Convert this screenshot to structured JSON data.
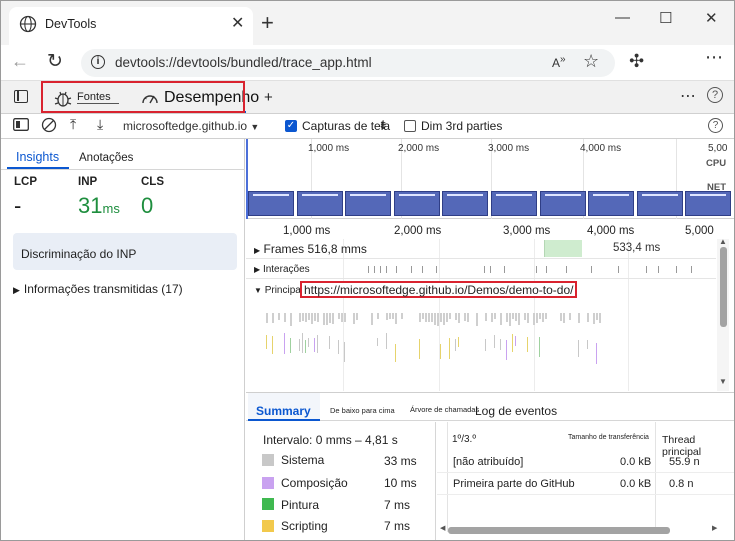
{
  "browser": {
    "tab_title": "DevTools",
    "tab_close": "✕",
    "new_tab": "+",
    "address": "devtools://devtools/bundled/trace_app.html",
    "window_controls": [
      "—",
      "☐",
      "✕"
    ]
  },
  "devtools": {
    "tabs": [
      {
        "label": "Fontes",
        "icon": "bug-icon"
      },
      {
        "label": "Desempenho",
        "icon": "speedometer-icon"
      }
    ],
    "add_tab": "+",
    "more": "⋯"
  },
  "perf_toolbar": {
    "recording_select": "microsoftedge.github.io",
    "screenshots_label": "Capturas de tela",
    "screenshots_checked": true,
    "dim_3rd_label": "Dim 3rd parties",
    "dim_3rd_checked": false
  },
  "sidebar": {
    "tabs": [
      "Insights",
      "Anotações"
    ],
    "metrics": [
      {
        "name": "LCP",
        "value": "-",
        "unit": ""
      },
      {
        "name": "INP",
        "value": "31",
        "unit": "ms"
      },
      {
        "name": "CLS",
        "value": "0",
        "unit": ""
      }
    ],
    "inp_breakdown": "Discriminação do INP",
    "transmitted": "Informações transmitidas (17)"
  },
  "overview": {
    "ticks": [
      "1,000 ms",
      "2,000 ms",
      "3,000 ms",
      "4,000 ms",
      "5,00"
    ],
    "cpu_label": "CPU",
    "net_label": "NET"
  },
  "timeline": {
    "ticks": [
      "1,000 ms",
      "2,000 ms",
      "3,000 ms",
      "4,000 ms",
      "5,000"
    ],
    "frames_label": "Frames 516,8 mms",
    "frames_value2": "533,4 ms",
    "interactions_label": "Interações",
    "main_label": "Principal",
    "main_url": "https://microsoftedge.github.io/Demos/demo-to-do/"
  },
  "bottom": {
    "tabs": [
      "Summary",
      "De baixo para cima",
      "Árvore de chamadas",
      "Log de eventos"
    ],
    "range": "Intervalo: 0 mms – 4,81 s",
    "summary": [
      {
        "label": "Sistema",
        "value": "33 ms",
        "color": "#c8c8c8"
      },
      {
        "label": "Composição",
        "value": "10 ms",
        "color": "#c9a2f0"
      },
      {
        "label": "Pintura",
        "value": "7 ms",
        "color": "#3fb950"
      },
      {
        "label": "Scripting",
        "value": "7 ms",
        "color": "#f2c94c"
      }
    ],
    "table": {
      "headers": [
        "1º/3.º",
        "Tamanho de transferência",
        "Thread principal"
      ],
      "rows": [
        {
          "name": "[não atribuído]",
          "size": "0.0 kB",
          "main": "55.9 n"
        },
        {
          "name": "Primeira parte do GitHub",
          "size": "0.0 kB",
          "main": "0.8 n"
        }
      ]
    }
  }
}
